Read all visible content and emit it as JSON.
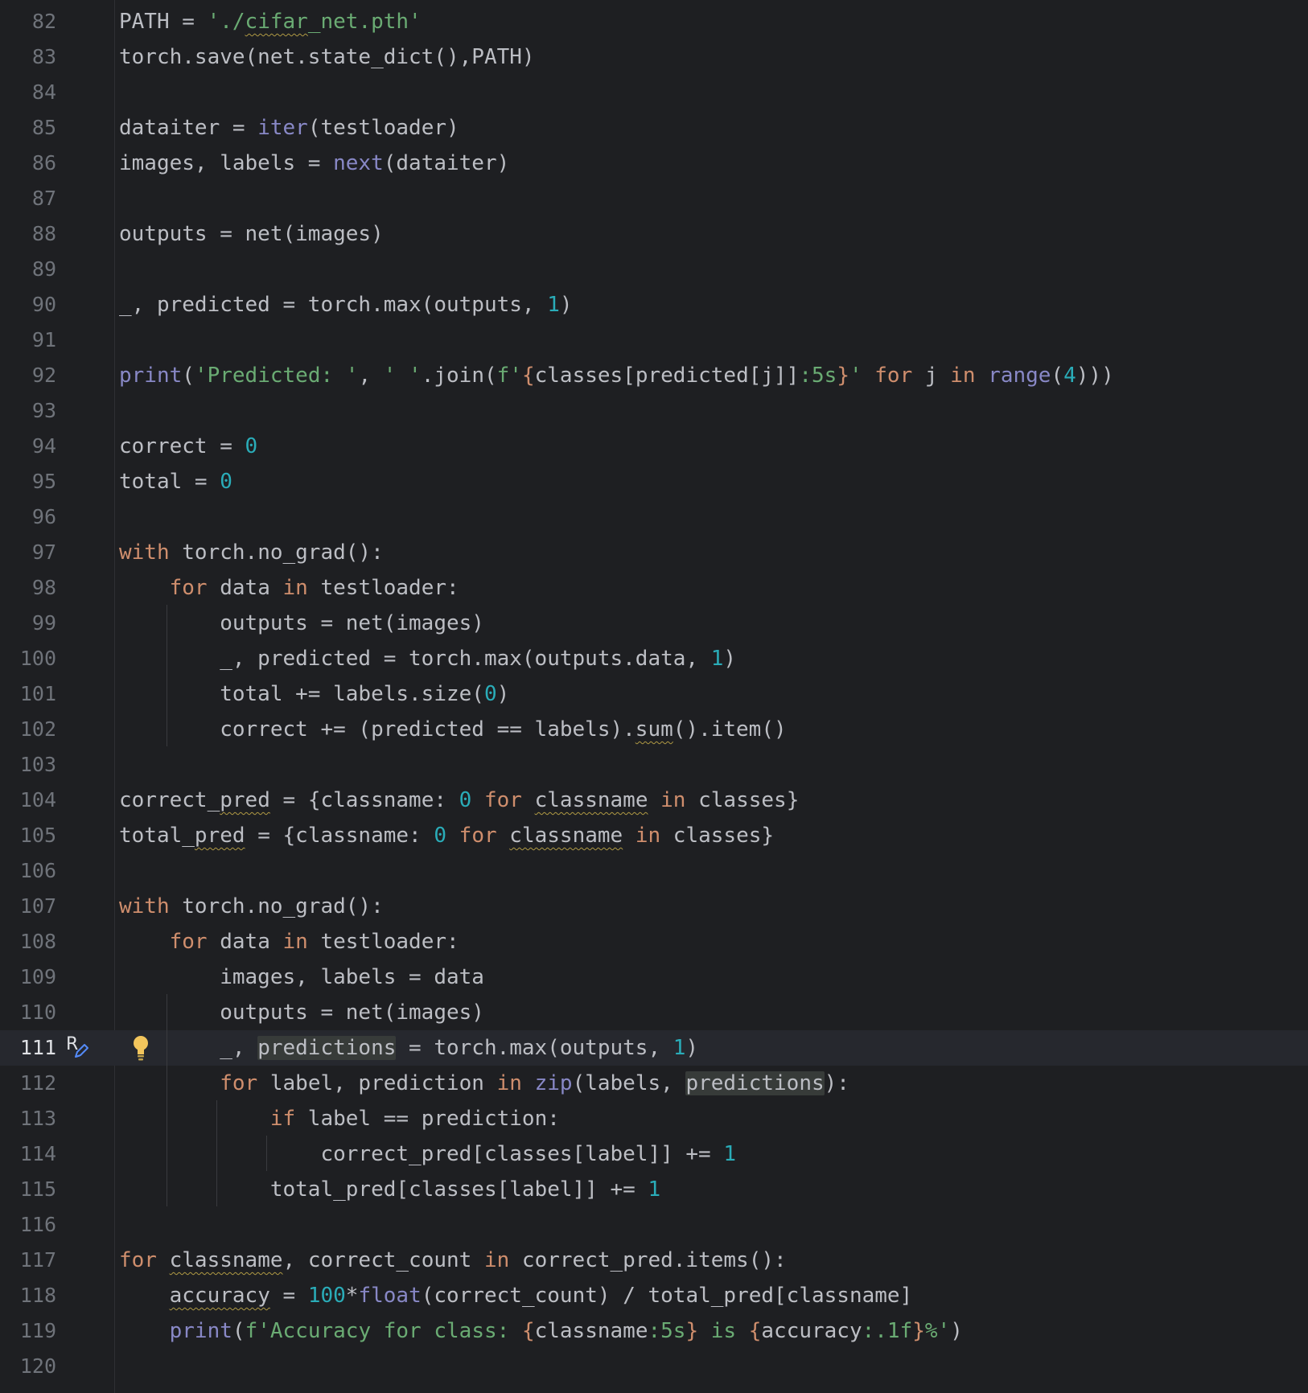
{
  "editor": {
    "current_line": "111",
    "lines": [
      {
        "n": "82",
        "code": [
          {
            "t": "PATH = "
          },
          {
            "t": "'./",
            "c": "s"
          },
          {
            "t": "cifar",
            "c": "s w"
          },
          {
            "t": "_net.pth'",
            "c": "s"
          }
        ]
      },
      {
        "n": "83",
        "code": [
          {
            "t": "torch.save(net.state_dict(),PATH)"
          }
        ]
      },
      {
        "n": "84",
        "code": []
      },
      {
        "n": "85",
        "code": [
          {
            "t": "dataiter = "
          },
          {
            "t": "iter",
            "c": "b"
          },
          {
            "t": "(testloader)"
          }
        ]
      },
      {
        "n": "86",
        "code": [
          {
            "t": "images, labels = "
          },
          {
            "t": "next",
            "c": "b"
          },
          {
            "t": "(dataiter)"
          }
        ]
      },
      {
        "n": "87",
        "code": []
      },
      {
        "n": "88",
        "code": [
          {
            "t": "outputs = net(images)"
          }
        ]
      },
      {
        "n": "89",
        "code": []
      },
      {
        "n": "90",
        "code": [
          {
            "t": "_, predicted = torch.max(outputs, "
          },
          {
            "t": "1",
            "c": "n"
          },
          {
            "t": ")"
          }
        ]
      },
      {
        "n": "91",
        "code": []
      },
      {
        "n": "92",
        "code": [
          {
            "t": "print",
            "c": "b"
          },
          {
            "t": "("
          },
          {
            "t": "'Predicted: '",
            "c": "s"
          },
          {
            "t": ", "
          },
          {
            "t": "' '",
            "c": "s"
          },
          {
            "t": ".join("
          },
          {
            "t": "f'",
            "c": "s"
          },
          {
            "t": "{",
            "c": "fb"
          },
          {
            "t": "classes[predicted[j]]"
          },
          {
            "t": ":5s",
            "c": "s"
          },
          {
            "t": "}",
            "c": "fb"
          },
          {
            "t": "'",
            "c": "s"
          },
          {
            "t": " "
          },
          {
            "t": "for",
            "c": "k"
          },
          {
            "t": " j "
          },
          {
            "t": "in",
            "c": "k"
          },
          {
            "t": " "
          },
          {
            "t": "range",
            "c": "b"
          },
          {
            "t": "("
          },
          {
            "t": "4",
            "c": "n"
          },
          {
            "t": ")))"
          }
        ]
      },
      {
        "n": "93",
        "code": []
      },
      {
        "n": "94",
        "code": [
          {
            "t": "correct = "
          },
          {
            "t": "0",
            "c": "n"
          }
        ]
      },
      {
        "n": "95",
        "code": [
          {
            "t": "total = "
          },
          {
            "t": "0",
            "c": "n"
          }
        ]
      },
      {
        "n": "96",
        "code": []
      },
      {
        "n": "97",
        "code": [
          {
            "t": "with",
            "c": "k"
          },
          {
            "t": " torch.no_grad():"
          }
        ]
      },
      {
        "n": "98",
        "code": [
          {
            "t": "    "
          },
          {
            "t": "for",
            "c": "k"
          },
          {
            "t": " data "
          },
          {
            "t": "in",
            "c": "k"
          },
          {
            "t": " testloader:"
          }
        ]
      },
      {
        "n": "99",
        "code": [
          {
            "t": "        outputs = net(images)"
          }
        ]
      },
      {
        "n": "100",
        "code": [
          {
            "t": "        _, predicted = torch.max(outputs.data, "
          },
          {
            "t": "1",
            "c": "n"
          },
          {
            "t": ")"
          }
        ]
      },
      {
        "n": "101",
        "code": [
          {
            "t": "        total += labels.size("
          },
          {
            "t": "0",
            "c": "n"
          },
          {
            "t": ")"
          }
        ]
      },
      {
        "n": "102",
        "code": [
          {
            "t": "        correct += (predicted == labels)."
          },
          {
            "t": "sum",
            "c": "w"
          },
          {
            "t": "().item()"
          }
        ]
      },
      {
        "n": "103",
        "code": []
      },
      {
        "n": "104",
        "code": [
          {
            "t": "correct_"
          },
          {
            "t": "pred",
            "c": "w"
          },
          {
            "t": " = {classname: "
          },
          {
            "t": "0",
            "c": "n"
          },
          {
            "t": " "
          },
          {
            "t": "for",
            "c": "k"
          },
          {
            "t": " "
          },
          {
            "t": "classname",
            "c": "w"
          },
          {
            "t": " "
          },
          {
            "t": "in",
            "c": "k"
          },
          {
            "t": " classes}"
          }
        ]
      },
      {
        "n": "105",
        "code": [
          {
            "t": "total_"
          },
          {
            "t": "pred",
            "c": "w"
          },
          {
            "t": " = {classname: "
          },
          {
            "t": "0",
            "c": "n"
          },
          {
            "t": " "
          },
          {
            "t": "for",
            "c": "k"
          },
          {
            "t": " "
          },
          {
            "t": "classname",
            "c": "w"
          },
          {
            "t": " "
          },
          {
            "t": "in",
            "c": "k"
          },
          {
            "t": " classes}"
          }
        ]
      },
      {
        "n": "106",
        "code": []
      },
      {
        "n": "107",
        "code": [
          {
            "t": "with",
            "c": "k"
          },
          {
            "t": " torch.no_grad():"
          }
        ]
      },
      {
        "n": "108",
        "code": [
          {
            "t": "    "
          },
          {
            "t": "for",
            "c": "k"
          },
          {
            "t": " data "
          },
          {
            "t": "in",
            "c": "k"
          },
          {
            "t": " testloader:"
          }
        ]
      },
      {
        "n": "109",
        "code": [
          {
            "t": "        images, labels = data"
          }
        ]
      },
      {
        "n": "110",
        "code": [
          {
            "t": "        outputs = net(images)"
          }
        ]
      },
      {
        "n": "111",
        "code": [
          {
            "t": "        _, "
          },
          {
            "t": "predictions",
            "c": "hl"
          },
          {
            "t": " = torch.max(outputs, "
          },
          {
            "t": "1",
            "c": "n"
          },
          {
            "t": ")"
          }
        ]
      },
      {
        "n": "112",
        "code": [
          {
            "t": "        "
          },
          {
            "t": "for",
            "c": "k"
          },
          {
            "t": " label, prediction "
          },
          {
            "t": "in",
            "c": "k"
          },
          {
            "t": " "
          },
          {
            "t": "zip",
            "c": "b"
          },
          {
            "t": "(labels, "
          },
          {
            "t": "predictions",
            "c": "hl"
          },
          {
            "t": "):"
          }
        ]
      },
      {
        "n": "113",
        "code": [
          {
            "t": "            "
          },
          {
            "t": "if",
            "c": "k"
          },
          {
            "t": " label == prediction:"
          }
        ]
      },
      {
        "n": "114",
        "code": [
          {
            "t": "                correct_pred[classes[label]] += "
          },
          {
            "t": "1",
            "c": "n"
          }
        ]
      },
      {
        "n": "115",
        "code": [
          {
            "t": "            total_pred[classes[label]] += "
          },
          {
            "t": "1",
            "c": "n"
          }
        ]
      },
      {
        "n": "116",
        "code": []
      },
      {
        "n": "117",
        "code": [
          {
            "t": "for",
            "c": "k"
          },
          {
            "t": " "
          },
          {
            "t": "classname",
            "c": "w"
          },
          {
            "t": ", correct_count "
          },
          {
            "t": "in",
            "c": "k"
          },
          {
            "t": " correct_pred.items():"
          }
        ]
      },
      {
        "n": "118",
        "code": [
          {
            "t": "    "
          },
          {
            "t": "accuracy",
            "c": "w"
          },
          {
            "t": " = "
          },
          {
            "t": "100",
            "c": "n"
          },
          {
            "t": "*"
          },
          {
            "t": "float",
            "c": "b"
          },
          {
            "t": "(correct_count) / total_pred[classname]"
          }
        ]
      },
      {
        "n": "119",
        "code": [
          {
            "t": "    "
          },
          {
            "t": "print",
            "c": "b"
          },
          {
            "t": "("
          },
          {
            "t": "f'Accuracy for class: ",
            "c": "s"
          },
          {
            "t": "{",
            "c": "fb"
          },
          {
            "t": "classname"
          },
          {
            "t": ":5s",
            "c": "s"
          },
          {
            "t": "}",
            "c": "fb"
          },
          {
            "t": " is ",
            "c": "s"
          },
          {
            "t": "{",
            "c": "fb"
          },
          {
            "t": "accuracy"
          },
          {
            "t": ":.1f",
            "c": "s"
          },
          {
            "t": "}",
            "c": "fb"
          },
          {
            "t": "%'",
            "c": "s"
          },
          {
            "t": ")"
          }
        ]
      },
      {
        "n": "120",
        "code": []
      }
    ]
  },
  "gutter": {
    "refactor_label": "R",
    "refactor_icon": "rename-refactor-icon",
    "intention_icon": "lightbulb-icon"
  },
  "colors": {
    "background": "#1e1f22",
    "keyword": "#cf8e6d",
    "builtin": "#8888c6",
    "string": "#6aab73",
    "number": "#2aacb8"
  }
}
